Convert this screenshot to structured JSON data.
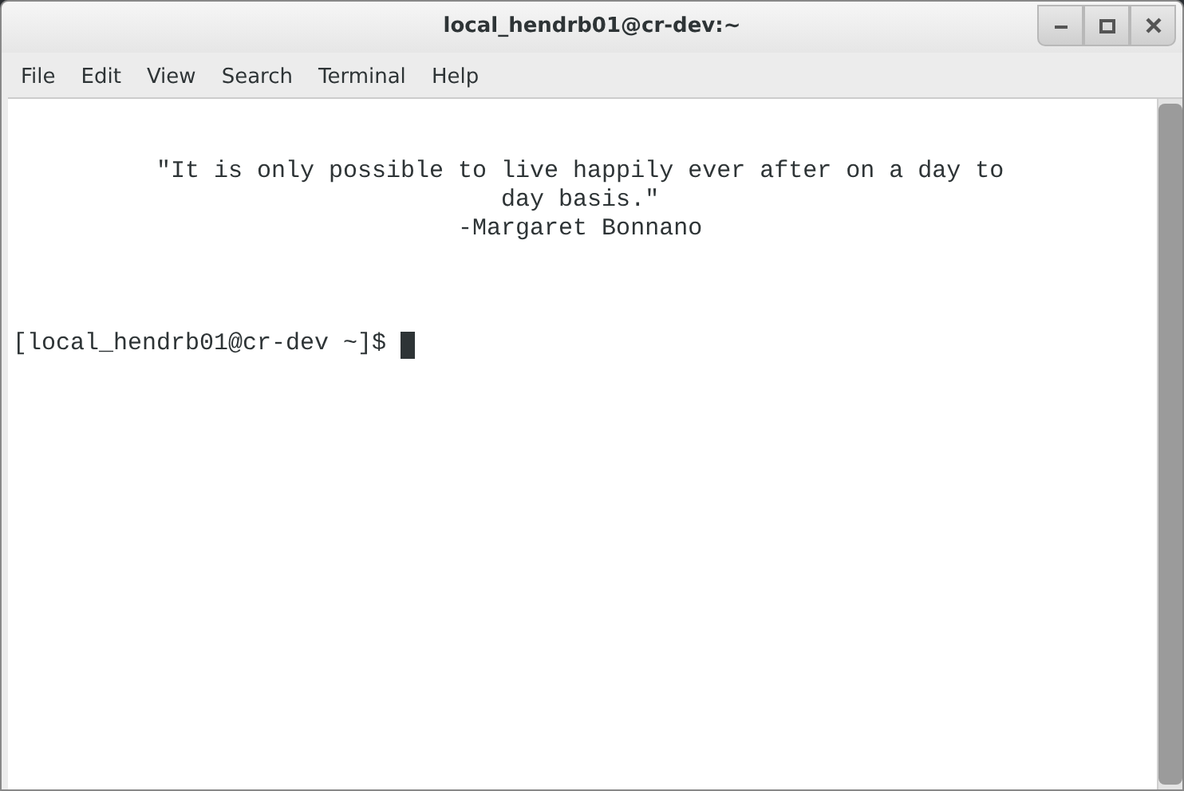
{
  "window": {
    "title": "local_hendrb01@cr-dev:~"
  },
  "menu": [
    "File",
    "Edit",
    "View",
    "Search",
    "Terminal",
    "Help"
  ],
  "terminal": {
    "quote_lines": [
      "          \"It is only possible to live happily ever after on a day to",
      "                                  day basis.\"",
      "                               -Margaret Bonnano"
    ],
    "prompt": "[local_hendrb01@cr-dev ~]$ "
  }
}
